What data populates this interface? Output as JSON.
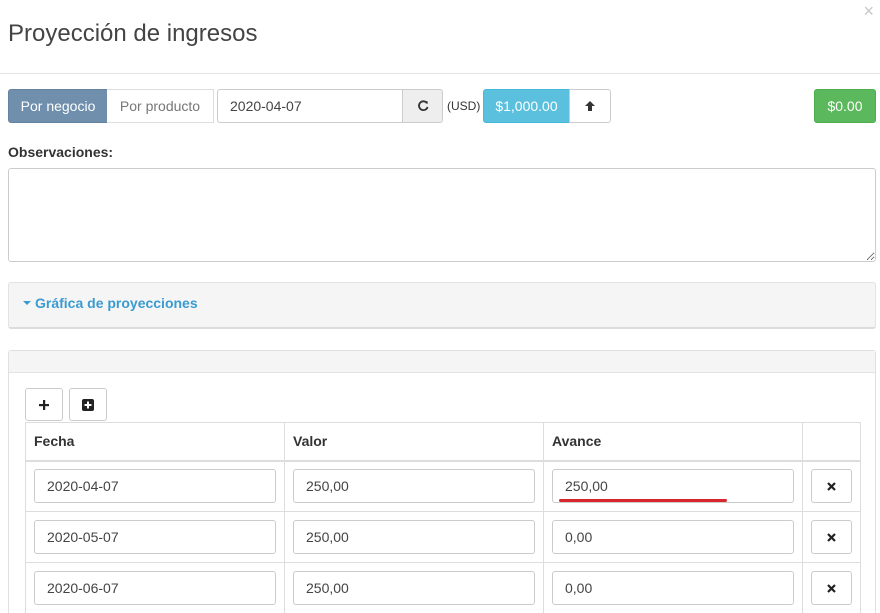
{
  "modal": {
    "title": "Proyección de ingresos",
    "close_label": "×"
  },
  "toolbar": {
    "mode_business": "Por negocio",
    "mode_product": "Por producto",
    "date_value": "2020-04-07",
    "currency": "(USD)",
    "amount": "$1,000.00",
    "total": "$0.00"
  },
  "observations": {
    "label": "Observaciones:",
    "value": ""
  },
  "chart_section": {
    "toggle_label": "Gráfica de proyecciones"
  },
  "table": {
    "headers": [
      "Fecha",
      "Valor",
      "Avance",
      ""
    ],
    "rows": [
      {
        "fecha": "2020-04-07",
        "valor": "250,00",
        "avance": "250,00"
      },
      {
        "fecha": "2020-05-07",
        "valor": "250,00",
        "avance": "0,00"
      },
      {
        "fecha": "2020-06-07",
        "valor": "250,00",
        "avance": "0,00"
      }
    ]
  },
  "colors": {
    "primary_segment": "#6f8fad",
    "info": "#5bc0de",
    "success": "#5cb85c",
    "link": "#3a9bd0",
    "annotation": "#d9262c"
  },
  "icons": {
    "refresh": "refresh-icon",
    "arrow_up": "arrow-up-icon",
    "plus": "plus-icon",
    "plus_square": "plus-square-icon",
    "remove": "times-icon"
  }
}
